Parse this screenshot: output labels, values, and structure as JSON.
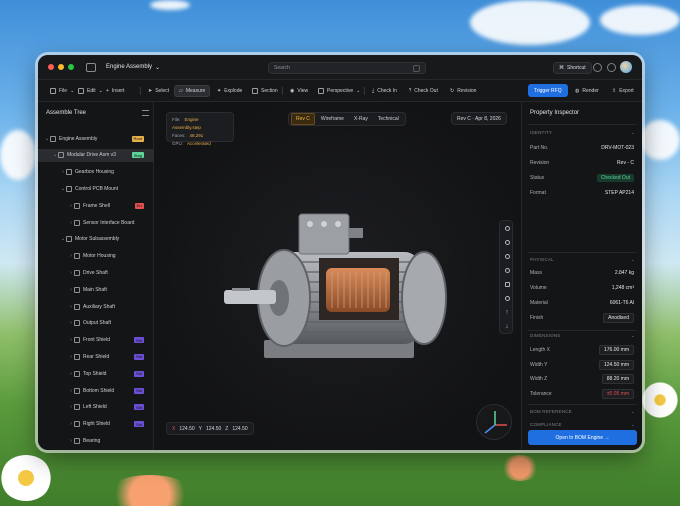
{
  "colors": {
    "accent": "#1f6fe0",
    "warning": "#e8b04a",
    "success": "#5fd39a",
    "danger": "#e05050",
    "badge_purple": "#6b4fd6"
  },
  "titlebar": {
    "doc_title": "Engine Assembly",
    "search_placeholder": "Search",
    "shortcut_label": "Shortcut"
  },
  "toolbar": {
    "items": [
      {
        "label": "File",
        "icon": "file-icon"
      },
      {
        "label": "Edit",
        "icon": "edit-icon"
      },
      {
        "label": "Insert",
        "icon": "plus-icon"
      },
      {
        "label": "Select",
        "icon": "cursor-icon"
      },
      {
        "label": "Measure",
        "icon": "ruler-icon"
      },
      {
        "label": "Explode",
        "icon": "explode-icon"
      },
      {
        "label": "Section",
        "icon": "section-icon"
      },
      {
        "label": "View",
        "icon": "eye-icon"
      },
      {
        "label": "Perspective",
        "icon": "cube-icon"
      },
      {
        "label": "Check In",
        "icon": "check-in-icon"
      },
      {
        "label": "Check Out",
        "icon": "check-out-icon"
      },
      {
        "label": "Revision",
        "icon": "revision-icon"
      }
    ],
    "rfq_label": "Trigger RFQ",
    "render_label": "Render",
    "export_label": "Export"
  },
  "assembly_tree": {
    "title": "Assemble Tree",
    "rows": [
      {
        "label": "Engine Assembly",
        "indent": 0,
        "chev": "⌄",
        "badge": "Root",
        "badge_color": "#e8b04a"
      },
      {
        "label": "Modular Drive Asm v3",
        "indent": 1,
        "chev": "⌄",
        "badge": "Stag",
        "badge_color": "#5fd39a",
        "selected": true
      },
      {
        "label": "Gearbox Housing",
        "indent": 2,
        "chev": "›",
        "badge": ""
      },
      {
        "label": "Control PCB Mount",
        "indent": 2,
        "chev": "⌄",
        "badge": ""
      },
      {
        "label": "Frame Shell",
        "indent": 3,
        "chev": "›",
        "badge": "Err",
        "badge_color": "#e05050"
      },
      {
        "label": "Sensor Interface Board",
        "indent": 3,
        "chev": "›",
        "badge": ""
      },
      {
        "label": "Motor Subassembly",
        "indent": 2,
        "chev": "⌄",
        "badge": ""
      },
      {
        "label": "Motor Housing",
        "indent": 3,
        "chev": "›",
        "badge": ""
      },
      {
        "label": "Drive Shaft",
        "indent": 3,
        "chev": "›",
        "badge": ""
      },
      {
        "label": "Main Shaft",
        "indent": 3,
        "chev": "›",
        "badge": ""
      },
      {
        "label": "Auxiliary Shaft",
        "indent": 3,
        "chev": "›",
        "badge": ""
      },
      {
        "label": "Output Shaft",
        "indent": 3,
        "chev": "›",
        "badge": ""
      },
      {
        "label": "Front Shield",
        "indent": 3,
        "chev": "›",
        "badge": "Std",
        "badge_color": "#6b4fd6"
      },
      {
        "label": "Rear Shield",
        "indent": 3,
        "chev": "›",
        "badge": "Std",
        "badge_color": "#6b4fd6"
      },
      {
        "label": "Top Shield",
        "indent": 3,
        "chev": "›",
        "badge": "Std",
        "badge_color": "#6b4fd6"
      },
      {
        "label": "Bottom Shield",
        "indent": 3,
        "chev": "›",
        "badge": "Std",
        "badge_color": "#6b4fd6"
      },
      {
        "label": "Left Shield",
        "indent": 3,
        "chev": "›",
        "badge": "Std",
        "badge_color": "#6b4fd6"
      },
      {
        "label": "Right Shield",
        "indent": 3,
        "chev": "›",
        "badge": "Std",
        "badge_color": "#6b4fd6"
      },
      {
        "label": "Bearing",
        "indent": 3,
        "chev": "›",
        "badge": ""
      }
    ]
  },
  "viewport": {
    "file_label": "File:",
    "file_value": "Engine Assembly.step",
    "faces_label": "Faces:",
    "faces_value": "48,291",
    "gpu_label": "GPU:",
    "gpu_value": "Accelerated",
    "modes": [
      "Rev C",
      "Wireframe",
      "X-Ray",
      "Technical"
    ],
    "active_mode": "Rev C",
    "revision_chip": "Rev C · Apr 8, 2026",
    "coords": [
      {
        "axis": "X",
        "value": "124.50"
      },
      {
        "axis": "Y",
        "value": "124.50"
      },
      {
        "axis": "Z",
        "value": "124.50"
      }
    ],
    "side_tools": [
      "gear-icon",
      "rotate-icon",
      "zoom-icon",
      "circle-icon",
      "grid-icon",
      "pin-icon",
      "arrow-up-icon",
      "arrow-down-icon"
    ]
  },
  "inspector": {
    "title": "Property Inspector",
    "identity_head": "IDENTITY",
    "identity": [
      {
        "k": "Part No.",
        "v": "DRV-MOT-023",
        "style": "plain"
      },
      {
        "k": "Revision",
        "v": "Rev - C",
        "style": "plain"
      },
      {
        "k": "Status",
        "v": "Checked Out",
        "style": "chip"
      },
      {
        "k": "Format",
        "v": "STEP AP214",
        "style": "plain"
      }
    ],
    "physical_head": "PHYSICAL",
    "physical": [
      {
        "k": "Mass",
        "v": "2.847 kg",
        "style": "plain"
      },
      {
        "k": "Volume",
        "v": "1,248 cm³",
        "style": "plain"
      },
      {
        "k": "Material",
        "v": "6061-T6 Al",
        "style": "plain"
      },
      {
        "k": "Finish",
        "v": "Anodised",
        "style": "box"
      }
    ],
    "dimensions_head": "DIMENSIONS",
    "dimensions": [
      {
        "k": "Length X",
        "v": "176.00 mm",
        "style": "box"
      },
      {
        "k": "Width Y",
        "v": "124.50 mm",
        "style": "box"
      },
      {
        "k": "Width Z",
        "v": "88.20 mm",
        "style": "box"
      },
      {
        "k": "Tolerance",
        "v": "±0.05 mm",
        "style": "danger"
      }
    ],
    "bom_head": "BOM REFERENCE",
    "compliance_head": "COMPLIANCE",
    "bom_button": "Open In BOM Engine →"
  }
}
